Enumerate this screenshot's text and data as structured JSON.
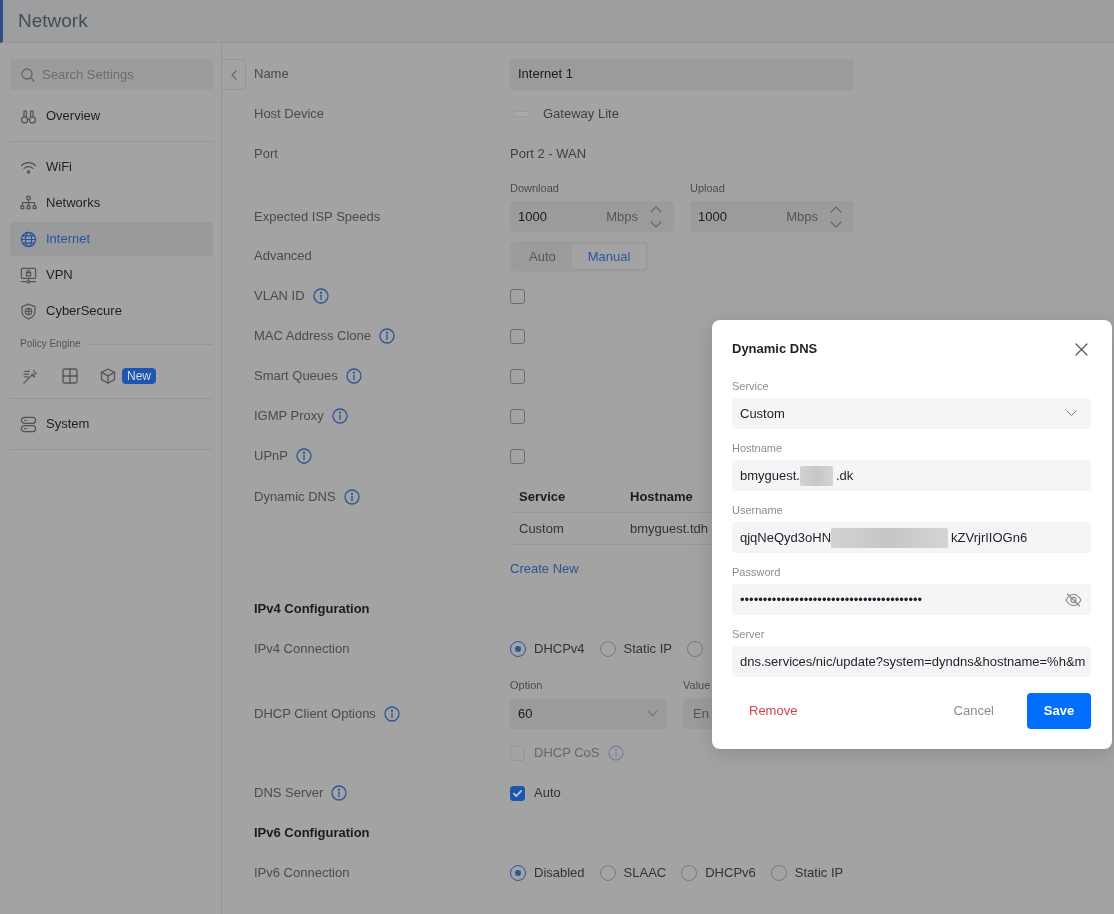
{
  "header": {
    "title": "Network"
  },
  "sidebar": {
    "search": {
      "placeholder": "Search Settings"
    },
    "groups": [
      {
        "kind": "items",
        "items": [
          {
            "label": "Overview",
            "selected": false
          }
        ]
      },
      {
        "kind": "items",
        "items": [
          {
            "label": "WiFi",
            "selected": false
          },
          {
            "label": "Networks",
            "selected": false
          },
          {
            "label": "Internet",
            "selected": true
          },
          {
            "label": "VPN",
            "selected": false
          },
          {
            "label": "CyberSecure",
            "selected": false
          }
        ]
      },
      {
        "kind": "tools",
        "title": "Policy Engine",
        "badge": "New"
      },
      {
        "kind": "items",
        "items": [
          {
            "label": "System",
            "selected": false
          }
        ]
      }
    ]
  },
  "form": {
    "rows": [
      {
        "kind": "input",
        "label": "Name",
        "value": "Internet 1"
      },
      {
        "kind": "device",
        "label": "Host Device",
        "value": "Gateway Lite"
      },
      {
        "kind": "text",
        "label": "Port",
        "value": "Port 2 - WAN"
      },
      {
        "kind": "speeds",
        "label": "Expected ISP Speeds",
        "fields": [
          {
            "caption": "Download",
            "value": "1000",
            "unit": "Mbps"
          },
          {
            "caption": "Upload",
            "value": "1000",
            "unit": "Mbps"
          }
        ]
      },
      {
        "kind": "segmented",
        "label": "Advanced",
        "options": [
          {
            "label": "Auto",
            "selected": false
          },
          {
            "label": "Manual",
            "selected": true
          }
        ]
      },
      {
        "kind": "checkbox",
        "label": "VLAN ID",
        "info": true,
        "checked": false,
        "disabled": false
      },
      {
        "kind": "checkbox",
        "label": "MAC Address Clone",
        "info": true,
        "checked": false,
        "disabled": false
      },
      {
        "kind": "checkbox",
        "label": "Smart Queues",
        "info": true,
        "checked": false,
        "disabled": false
      },
      {
        "kind": "checkbox",
        "label": "IGMP Proxy",
        "info": true,
        "checked": false,
        "disabled": false
      },
      {
        "kind": "checkbox",
        "label": "UPnP",
        "info": true,
        "checked": false,
        "disabled": false
      },
      {
        "kind": "ddns",
        "label": "Dynamic DNS",
        "info": true,
        "table": {
          "columns": [
            "Service",
            "Hostname"
          ],
          "rows": [
            [
              "Custom",
              "bmyguest.tdh"
            ]
          ]
        },
        "link": "Create New"
      },
      {
        "kind": "heading",
        "label": "IPv4 Configuration"
      },
      {
        "kind": "radio",
        "label": "IPv4 Connection",
        "options": [
          {
            "label": "DHCPv4",
            "selected": true
          },
          {
            "label": "Static IP",
            "selected": false
          },
          {
            "selected": false
          }
        ]
      },
      {
        "kind": "dhcp_options",
        "label": "DHCP Client Options",
        "info": true,
        "select": {
          "caption": "Option",
          "value": "60"
        },
        "entry": {
          "caption": "Value",
          "placeholder": "En"
        }
      },
      {
        "kind": "checkbox",
        "text": "DHCP CoS",
        "info": true,
        "checked": false,
        "disabled": true
      },
      {
        "kind": "checkbox",
        "label": "DNS Server",
        "info": true,
        "text": "Auto",
        "checked": true,
        "disabled": false
      },
      {
        "kind": "heading",
        "label": "IPv6 Configuration"
      },
      {
        "kind": "radio",
        "label": "IPv6 Connection",
        "options": [
          {
            "label": "Disabled",
            "selected": true
          },
          {
            "label": "SLAAC",
            "selected": false
          },
          {
            "label": "DHCPv6",
            "selected": false
          },
          {
            "label": "Static IP",
            "selected": false
          }
        ]
      }
    ]
  },
  "dialog": {
    "title": "Dynamic DNS",
    "fields": [
      {
        "kind": "select",
        "label": "Service",
        "value": "Custom"
      },
      {
        "kind": "redacted",
        "label": "Hostname",
        "parts": [
          "bmyguest.",
          ".dk"
        ]
      },
      {
        "kind": "redacted",
        "label": "Username",
        "parts": [
          "qjqNeQyd3oHN",
          "kZVrjrIIOGn6"
        ]
      },
      {
        "kind": "password",
        "label": "Password",
        "value": "••••••••••••••••••••••••••••••••••••••••"
      },
      {
        "kind": "text",
        "label": "Server",
        "value": "dns.services/nic/update?system=dyndns&hostname=%h&m"
      }
    ],
    "actions": [
      {
        "kind": "danger",
        "label": "Remove"
      },
      {
        "kind": "secondary",
        "label": "Cancel"
      },
      {
        "kind": "primary",
        "label": "Save"
      }
    ]
  }
}
